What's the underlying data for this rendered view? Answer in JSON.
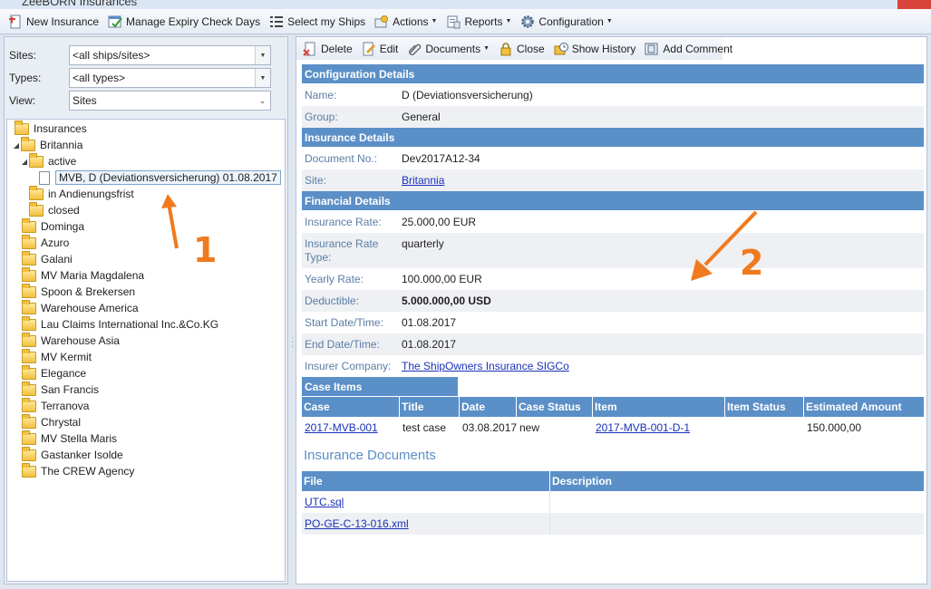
{
  "window": {
    "title": "ZeeBORN Insurances"
  },
  "main_toolbar": [
    {
      "id": "new-insurance",
      "label": "New Insurance",
      "icon": "new-document-icon",
      "dropdown": false
    },
    {
      "id": "manage-expiry",
      "label": "Manage Expiry Check Days",
      "icon": "calendar-check-icon",
      "dropdown": false
    },
    {
      "id": "select-ships",
      "label": "Select my Ships",
      "icon": "list-icon",
      "dropdown": false
    },
    {
      "id": "actions",
      "label": "Actions",
      "icon": "actions-icon",
      "dropdown": true
    },
    {
      "id": "reports",
      "label": "Reports",
      "icon": "report-icon",
      "dropdown": true
    },
    {
      "id": "configuration",
      "label": "Configuration",
      "icon": "gear-icon",
      "dropdown": true
    }
  ],
  "filters": {
    "sites": {
      "label": "Sites:",
      "value": "<all ships/sites>"
    },
    "types": {
      "label": "Types:",
      "value": "<all types>"
    },
    "view": {
      "label": "View:",
      "value": "Sites"
    }
  },
  "tree": [
    {
      "label": "Insurances",
      "level": 0,
      "expander": "",
      "icon": "folder"
    },
    {
      "label": "Britannia",
      "level": 0,
      "expander": "◢",
      "icon": "folder"
    },
    {
      "label": "active",
      "level": 1,
      "expander": "◢",
      "icon": "folder"
    },
    {
      "label": "MVB, D (Deviationsversicherung) 01.08.2017",
      "level": 2,
      "expander": "",
      "icon": "document",
      "selected": true
    },
    {
      "label": "in Andienungsfrist",
      "level": 1,
      "expander": "",
      "icon": "folder"
    },
    {
      "label": "closed",
      "level": 1,
      "expander": "",
      "icon": "folder"
    },
    {
      "label": "Dominga",
      "level": 0,
      "expander": "",
      "icon": "folder"
    },
    {
      "label": "Azuro",
      "level": 0,
      "expander": "",
      "icon": "folder"
    },
    {
      "label": "Galani",
      "level": 0,
      "expander": "",
      "icon": "folder"
    },
    {
      "label": "MV Maria Magdalena",
      "level": 0,
      "expander": "",
      "icon": "folder"
    },
    {
      "label": "Spoon & Brekersen",
      "level": 0,
      "expander": "",
      "icon": "folder"
    },
    {
      "label": "Warehouse America",
      "level": 0,
      "expander": "",
      "icon": "folder"
    },
    {
      "label": "Lau Claims International Inc.&Co.KG",
      "level": 0,
      "expander": "",
      "icon": "folder"
    },
    {
      "label": "Warehouse Asia",
      "level": 0,
      "expander": "",
      "icon": "folder"
    },
    {
      "label": "MV Kermit",
      "level": 0,
      "expander": "",
      "icon": "folder"
    },
    {
      "label": "Elegance",
      "level": 0,
      "expander": "",
      "icon": "folder"
    },
    {
      "label": "San Francis",
      "level": 0,
      "expander": "",
      "icon": "folder"
    },
    {
      "label": "Terranova",
      "level": 0,
      "expander": "",
      "icon": "folder"
    },
    {
      "label": "Chrystal",
      "level": 0,
      "expander": "",
      "icon": "folder"
    },
    {
      "label": "MV Stella Maris",
      "level": 0,
      "expander": "",
      "icon": "folder"
    },
    {
      "label": "Gastanker Isolde",
      "level": 0,
      "expander": "",
      "icon": "folder"
    },
    {
      "label": "The CREW Agency",
      "level": 0,
      "expander": "",
      "icon": "folder"
    }
  ],
  "annotations": {
    "one": "1",
    "two": "2",
    "color": "#f07a1e"
  },
  "detail_toolbar": [
    {
      "id": "delete",
      "label": "Delete",
      "icon": "delete-icon",
      "dropdown": false
    },
    {
      "id": "edit",
      "label": "Edit",
      "icon": "edit-icon",
      "dropdown": false
    },
    {
      "id": "documents",
      "label": "Documents",
      "icon": "paperclip-icon",
      "dropdown": true
    },
    {
      "id": "close",
      "label": "Close",
      "icon": "lock-icon",
      "dropdown": false
    },
    {
      "id": "show-history",
      "label": "Show History",
      "icon": "history-icon",
      "dropdown": false
    },
    {
      "id": "add-comment",
      "label": "Add Comment",
      "icon": "comment-icon",
      "dropdown": false
    }
  ],
  "sections": {
    "configuration": {
      "title": "Configuration Details",
      "rows": [
        {
          "label": "Name:",
          "value": "D (Deviationsversicherung)"
        },
        {
          "label": "Group:",
          "value": "General"
        }
      ]
    },
    "insurance": {
      "title": "Insurance Details",
      "rows": [
        {
          "label": "Document No.:",
          "value": "Dev2017A12-34"
        },
        {
          "label": "Site:",
          "value": "Britannia",
          "link": true
        }
      ]
    },
    "financial": {
      "title": "Financial Details",
      "rows": [
        {
          "label": "Insurance Rate:",
          "value": "25.000,00 EUR"
        },
        {
          "label": "Insurance Rate Type:",
          "value": "quarterly"
        },
        {
          "label": "Yearly Rate:",
          "value": "100.000,00 EUR"
        },
        {
          "label": "Deductible:",
          "value": "5.000.000,00 USD",
          "bold": true
        },
        {
          "label": "Start Date/Time:",
          "value": "01.08.2017"
        },
        {
          "label": "End Date/Time:",
          "value": "01.08.2017"
        },
        {
          "label": "Insurer Company:",
          "value": "The ShipOwners Insurance SIGCo",
          "link": true
        }
      ]
    }
  },
  "case_items": {
    "title": "Case Items",
    "columns": [
      "Case",
      "Title",
      "Date",
      "Case Status",
      "Item",
      "Item Status",
      "Estimated Amount"
    ],
    "rows": [
      [
        "2017-MVB-001",
        "test case",
        "03.08.2017",
        "new",
        "2017-MVB-001-D-1",
        "",
        "150.000,00"
      ]
    ]
  },
  "documents": {
    "title": "Insurance Documents",
    "columns": [
      "File",
      "Description"
    ],
    "rows": [
      [
        "UTC.sql",
        ""
      ],
      [
        "PO-GE-C-13-016.xml",
        ""
      ]
    ]
  },
  "colors": {
    "header_blue": "#5b8fc7",
    "label_blue": "#5a7da6",
    "link": "#1a31b8",
    "annotation": "#f07a1e"
  }
}
